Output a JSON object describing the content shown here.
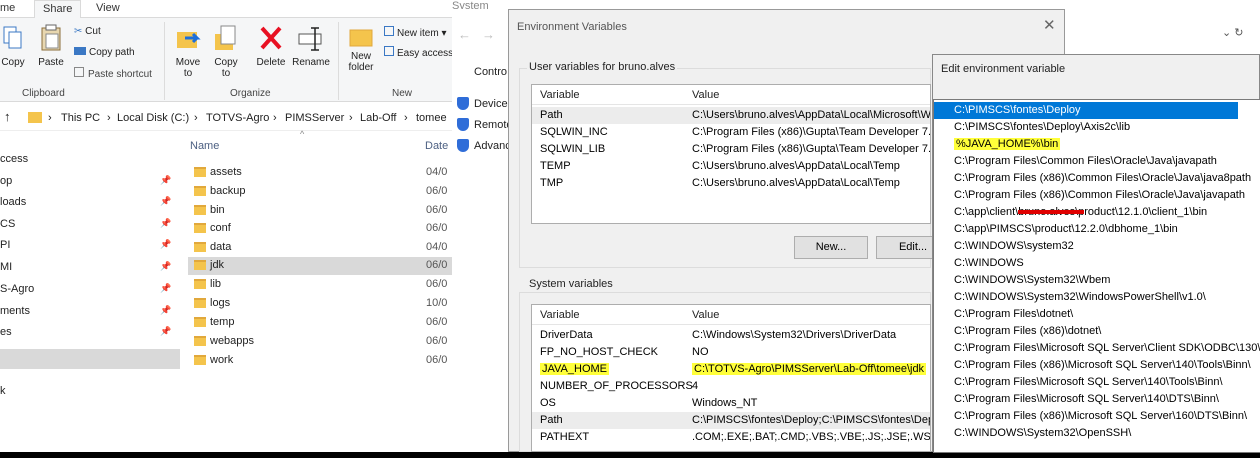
{
  "explorer": {
    "tabs": [
      "me",
      "Share",
      "View"
    ],
    "ribbon": {
      "clipboard": {
        "copy": "Copy",
        "paste": "Paste",
        "cut": "Cut",
        "copy_path": "Copy path",
        "paste_shortcut": "Paste shortcut",
        "group": "Clipboard"
      },
      "organize": {
        "move_to": "Move to",
        "copy_to": "Copy to",
        "delete": "Delete",
        "rename": "Rename",
        "group": "Organize"
      },
      "new": {
        "new_folder": "New folder",
        "new_item": "New item",
        "easy_access": "Easy access",
        "group": "New"
      }
    },
    "breadcrumb": [
      "This PC",
      "Local Disk (C:)",
      "TOTVS-Agro",
      "PIMSServer",
      "Lab-Off",
      "tomee"
    ],
    "nav_items": [
      "ccess",
      "op",
      "loads",
      "CS",
      "PI",
      "MI",
      "S-Agro",
      "ments",
      "es",
      "",
      "k"
    ],
    "columns": {
      "name": "Name",
      "date": "Date"
    },
    "files": [
      {
        "name": "assets",
        "date": "04/0"
      },
      {
        "name": "backup",
        "date": "06/0"
      },
      {
        "name": "bin",
        "date": "06/0"
      },
      {
        "name": "conf",
        "date": "06/0"
      },
      {
        "name": "data",
        "date": "04/0"
      },
      {
        "name": "jdk",
        "date": "06/0"
      },
      {
        "name": "lib",
        "date": "06/0"
      },
      {
        "name": "logs",
        "date": "10/0"
      },
      {
        "name": "temp",
        "date": "06/0"
      },
      {
        "name": "webapps",
        "date": "06/0"
      },
      {
        "name": "work",
        "date": "06/0"
      }
    ]
  },
  "behind": {
    "title": "System",
    "links": [
      "Contro",
      "Device",
      "Remote",
      "Advanc"
    ]
  },
  "env_dialog": {
    "title": "Environment Variables",
    "user_group": "User variables for bruno.alves",
    "col_variable": "Variable",
    "col_value": "Value",
    "user_vars": [
      {
        "name": "Path",
        "value": "C:\\Users\\bruno.alves\\AppData\\Local\\Microsoft\\Wi"
      },
      {
        "name": "SQLWIN_INC",
        "value": "C:\\Program Files (x86)\\Gupta\\Team Developer 7.3\\i"
      },
      {
        "name": "SQLWIN_LIB",
        "value": "C:\\Program Files (x86)\\Gupta\\Team Developer 7.3\\l"
      },
      {
        "name": "TEMP",
        "value": "C:\\Users\\bruno.alves\\AppData\\Local\\Temp"
      },
      {
        "name": "TMP",
        "value": "C:\\Users\\bruno.alves\\AppData\\Local\\Temp"
      }
    ],
    "new_button": "New...",
    "edit_button": "Edit...",
    "system_group": "System variables",
    "system_vars": [
      {
        "name": "DriverData",
        "value": "C:\\Windows\\System32\\Drivers\\DriverData"
      },
      {
        "name": "FP_NO_HOST_CHECK",
        "value": "NO"
      },
      {
        "name": "JAVA_HOME",
        "value": "C:\\TOTVS-Agro\\PIMSServer\\Lab-Off\\tomee\\jdk"
      },
      {
        "name": "NUMBER_OF_PROCESSORS",
        "value": "4"
      },
      {
        "name": "OS",
        "value": "Windows_NT"
      },
      {
        "name": "Path",
        "value": "C:\\PIMSCS\\fontes\\Deploy;C:\\PIMSCS\\fontes\\Deplo"
      },
      {
        "name": "PATHEXT",
        "value": ".COM;.EXE;.BAT;.CMD;.VBS;.VBE;.JS;.JSE;.WSF;.WSH;"
      }
    ]
  },
  "edit_dialog": {
    "title": "Edit environment variable",
    "entries": [
      "C:\\PIMSCS\\fontes\\Deploy",
      "C:\\PIMSCS\\fontes\\Deploy\\Axis2c\\lib",
      "%JAVA_HOME%\\bin",
      "C:\\Program Files\\Common Files\\Oracle\\Java\\javapath",
      "C:\\Program Files (x86)\\Common Files\\Oracle\\Java\\java8path",
      "C:\\Program Files (x86)\\Common Files\\Oracle\\Java\\javapath",
      "C:\\app\\client\\bruno.alves\\product\\12.1.0\\client_1\\bin",
      "C:\\app\\PIMSCS\\product\\12.2.0\\dbhome_1\\bin",
      "C:\\WINDOWS\\system32",
      "C:\\WINDOWS",
      "C:\\WINDOWS\\System32\\Wbem",
      "C:\\WINDOWS\\System32\\WindowsPowerShell\\v1.0\\",
      "C:\\Program Files\\dotnet\\",
      "C:\\Program Files (x86)\\dotnet\\",
      "C:\\Program Files\\Microsoft SQL Server\\Client SDK\\ODBC\\130\\T",
      "C:\\Program Files (x86)\\Microsoft SQL Server\\140\\Tools\\Binn\\",
      "C:\\Program Files\\Microsoft SQL Server\\140\\Tools\\Binn\\",
      "C:\\Program Files\\Microsoft SQL Server\\140\\DTS\\Binn\\",
      "C:\\Program Files (x86)\\Microsoft SQL Server\\160\\DTS\\Binn\\",
      "C:\\WINDOWS\\System32\\OpenSSH\\"
    ]
  },
  "colors": {
    "highlight": "#ffff3a",
    "selection": "#0078d7",
    "redaction": "#e00000"
  }
}
